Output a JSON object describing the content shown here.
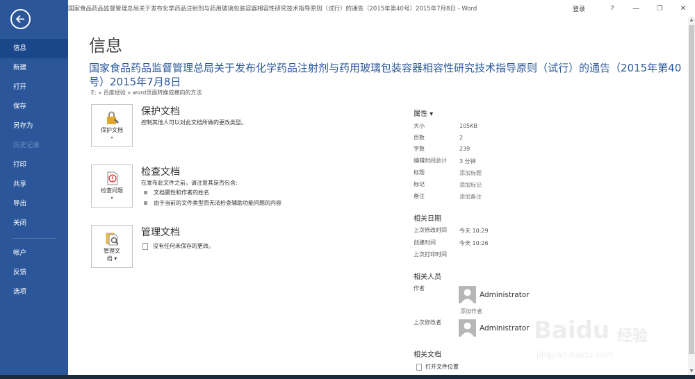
{
  "window": {
    "title": "国家食品药品监督管理总局关于发布化学药品注射剂与药用玻璃包装容器相容性研究技术指导原则（试行）的通告（2015年第40号）2015年7月8日 - Word",
    "signin": "登录",
    "help": "?",
    "minimize": "—",
    "restore": "❐",
    "close": "✕"
  },
  "sidebar": {
    "back_icon": "back-arrow-icon",
    "items": [
      {
        "label": "信息",
        "state": "active"
      },
      {
        "label": "新建",
        "state": "normal"
      },
      {
        "label": "打开",
        "state": "normal"
      },
      {
        "label": "保存",
        "state": "normal"
      },
      {
        "label": "另存为",
        "state": "normal"
      },
      {
        "label": "历史记录",
        "state": "disabled"
      },
      {
        "label": "打印",
        "state": "normal"
      },
      {
        "label": "共享",
        "state": "normal"
      },
      {
        "label": "导出",
        "state": "normal"
      },
      {
        "label": "关闭",
        "state": "normal"
      }
    ],
    "items2": [
      {
        "label": "帐户"
      },
      {
        "label": "反馈"
      },
      {
        "label": "选项"
      }
    ]
  },
  "main": {
    "heading": "信息",
    "doc_title": "国家食品药品监督管理总局关于发布化学药品注射剂与药用玻璃包装容器相容性研究技术指导原则（试行）的通告（2015年第40号）2015年7月8日",
    "path": "E: » 百度经验 » word页面转换成横向的方法",
    "protect": {
      "tile_label": "保护文档",
      "caret": "▾",
      "title": "保护文档",
      "desc": "控制其他人可以对此文档所做的更改类型。"
    },
    "inspect": {
      "tile_label": "检查问题",
      "caret": "▾",
      "title": "检查文档",
      "desc": "在发布此文件之前，请注意其是否包含:",
      "bullets": [
        "文档属性和作者的姓名",
        "由于当前的文件类型而无法检查辅助功能问题的内容"
      ]
    },
    "manage": {
      "tile_label_1": "管理文",
      "tile_label_2": "档 ▾",
      "title": "管理文档",
      "note": "没有任何未保存的更改。"
    }
  },
  "properties": {
    "heading": "属性 ▾",
    "rows": [
      {
        "label": "大小",
        "value": "105KB",
        "link": false
      },
      {
        "label": "页数",
        "value": "2",
        "link": false
      },
      {
        "label": "字数",
        "value": "239",
        "link": false
      },
      {
        "label": "编辑时间总计",
        "value": "3 分钟",
        "link": false
      },
      {
        "label": "标题",
        "value": "添加标题",
        "link": true
      },
      {
        "label": "标记",
        "value": "添加标记",
        "link": true
      },
      {
        "label": "备注",
        "value": "添加备注",
        "link": true
      }
    ],
    "dates_heading": "相关日期",
    "dates": [
      {
        "label": "上次修改时间",
        "value": "今天 10:29"
      },
      {
        "label": "创建时间",
        "value": "今天 10:26"
      },
      {
        "label": "上次打印时间",
        "value": ""
      }
    ],
    "people_heading": "相关人员",
    "author_label": "作者",
    "author_name": "Administrator",
    "add_author": "添加作者",
    "modifier_label": "上次修改者",
    "modifier_name": "Administrator",
    "docs_heading": "相关文档",
    "open_location": "打开文件位置"
  },
  "watermark": {
    "brand": "Baidu",
    "jingyan": "经验",
    "url": "jingyan.baidu.com"
  },
  "colors": {
    "sidebar": "#2b579a",
    "sidebar_active": "#19478a",
    "accent_title": "#2b579a"
  }
}
